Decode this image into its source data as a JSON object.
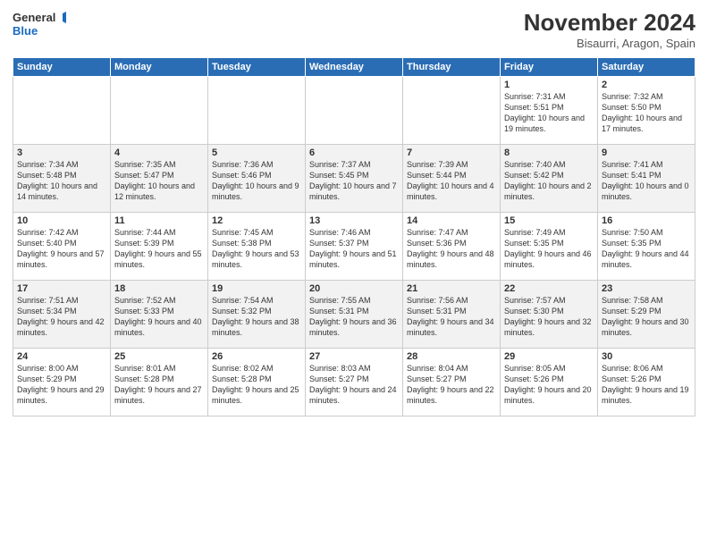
{
  "logo": {
    "line1": "General",
    "line2": "Blue"
  },
  "title": "November 2024",
  "subtitle": "Bisaurri, Aragon, Spain",
  "days_header": [
    "Sunday",
    "Monday",
    "Tuesday",
    "Wednesday",
    "Thursday",
    "Friday",
    "Saturday"
  ],
  "weeks": [
    [
      {
        "num": "",
        "info": ""
      },
      {
        "num": "",
        "info": ""
      },
      {
        "num": "",
        "info": ""
      },
      {
        "num": "",
        "info": ""
      },
      {
        "num": "",
        "info": ""
      },
      {
        "num": "1",
        "info": "Sunrise: 7:31 AM\nSunset: 5:51 PM\nDaylight: 10 hours and 19 minutes."
      },
      {
        "num": "2",
        "info": "Sunrise: 7:32 AM\nSunset: 5:50 PM\nDaylight: 10 hours and 17 minutes."
      }
    ],
    [
      {
        "num": "3",
        "info": "Sunrise: 7:34 AM\nSunset: 5:48 PM\nDaylight: 10 hours and 14 minutes."
      },
      {
        "num": "4",
        "info": "Sunrise: 7:35 AM\nSunset: 5:47 PM\nDaylight: 10 hours and 12 minutes."
      },
      {
        "num": "5",
        "info": "Sunrise: 7:36 AM\nSunset: 5:46 PM\nDaylight: 10 hours and 9 minutes."
      },
      {
        "num": "6",
        "info": "Sunrise: 7:37 AM\nSunset: 5:45 PM\nDaylight: 10 hours and 7 minutes."
      },
      {
        "num": "7",
        "info": "Sunrise: 7:39 AM\nSunset: 5:44 PM\nDaylight: 10 hours and 4 minutes."
      },
      {
        "num": "8",
        "info": "Sunrise: 7:40 AM\nSunset: 5:42 PM\nDaylight: 10 hours and 2 minutes."
      },
      {
        "num": "9",
        "info": "Sunrise: 7:41 AM\nSunset: 5:41 PM\nDaylight: 10 hours and 0 minutes."
      }
    ],
    [
      {
        "num": "10",
        "info": "Sunrise: 7:42 AM\nSunset: 5:40 PM\nDaylight: 9 hours and 57 minutes."
      },
      {
        "num": "11",
        "info": "Sunrise: 7:44 AM\nSunset: 5:39 PM\nDaylight: 9 hours and 55 minutes."
      },
      {
        "num": "12",
        "info": "Sunrise: 7:45 AM\nSunset: 5:38 PM\nDaylight: 9 hours and 53 minutes."
      },
      {
        "num": "13",
        "info": "Sunrise: 7:46 AM\nSunset: 5:37 PM\nDaylight: 9 hours and 51 minutes."
      },
      {
        "num": "14",
        "info": "Sunrise: 7:47 AM\nSunset: 5:36 PM\nDaylight: 9 hours and 48 minutes."
      },
      {
        "num": "15",
        "info": "Sunrise: 7:49 AM\nSunset: 5:35 PM\nDaylight: 9 hours and 46 minutes."
      },
      {
        "num": "16",
        "info": "Sunrise: 7:50 AM\nSunset: 5:35 PM\nDaylight: 9 hours and 44 minutes."
      }
    ],
    [
      {
        "num": "17",
        "info": "Sunrise: 7:51 AM\nSunset: 5:34 PM\nDaylight: 9 hours and 42 minutes."
      },
      {
        "num": "18",
        "info": "Sunrise: 7:52 AM\nSunset: 5:33 PM\nDaylight: 9 hours and 40 minutes."
      },
      {
        "num": "19",
        "info": "Sunrise: 7:54 AM\nSunset: 5:32 PM\nDaylight: 9 hours and 38 minutes."
      },
      {
        "num": "20",
        "info": "Sunrise: 7:55 AM\nSunset: 5:31 PM\nDaylight: 9 hours and 36 minutes."
      },
      {
        "num": "21",
        "info": "Sunrise: 7:56 AM\nSunset: 5:31 PM\nDaylight: 9 hours and 34 minutes."
      },
      {
        "num": "22",
        "info": "Sunrise: 7:57 AM\nSunset: 5:30 PM\nDaylight: 9 hours and 32 minutes."
      },
      {
        "num": "23",
        "info": "Sunrise: 7:58 AM\nSunset: 5:29 PM\nDaylight: 9 hours and 30 minutes."
      }
    ],
    [
      {
        "num": "24",
        "info": "Sunrise: 8:00 AM\nSunset: 5:29 PM\nDaylight: 9 hours and 29 minutes."
      },
      {
        "num": "25",
        "info": "Sunrise: 8:01 AM\nSunset: 5:28 PM\nDaylight: 9 hours and 27 minutes."
      },
      {
        "num": "26",
        "info": "Sunrise: 8:02 AM\nSunset: 5:28 PM\nDaylight: 9 hours and 25 minutes."
      },
      {
        "num": "27",
        "info": "Sunrise: 8:03 AM\nSunset: 5:27 PM\nDaylight: 9 hours and 24 minutes."
      },
      {
        "num": "28",
        "info": "Sunrise: 8:04 AM\nSunset: 5:27 PM\nDaylight: 9 hours and 22 minutes."
      },
      {
        "num": "29",
        "info": "Sunrise: 8:05 AM\nSunset: 5:26 PM\nDaylight: 9 hours and 20 minutes."
      },
      {
        "num": "30",
        "info": "Sunrise: 8:06 AM\nSunset: 5:26 PM\nDaylight: 9 hours and 19 minutes."
      }
    ]
  ]
}
